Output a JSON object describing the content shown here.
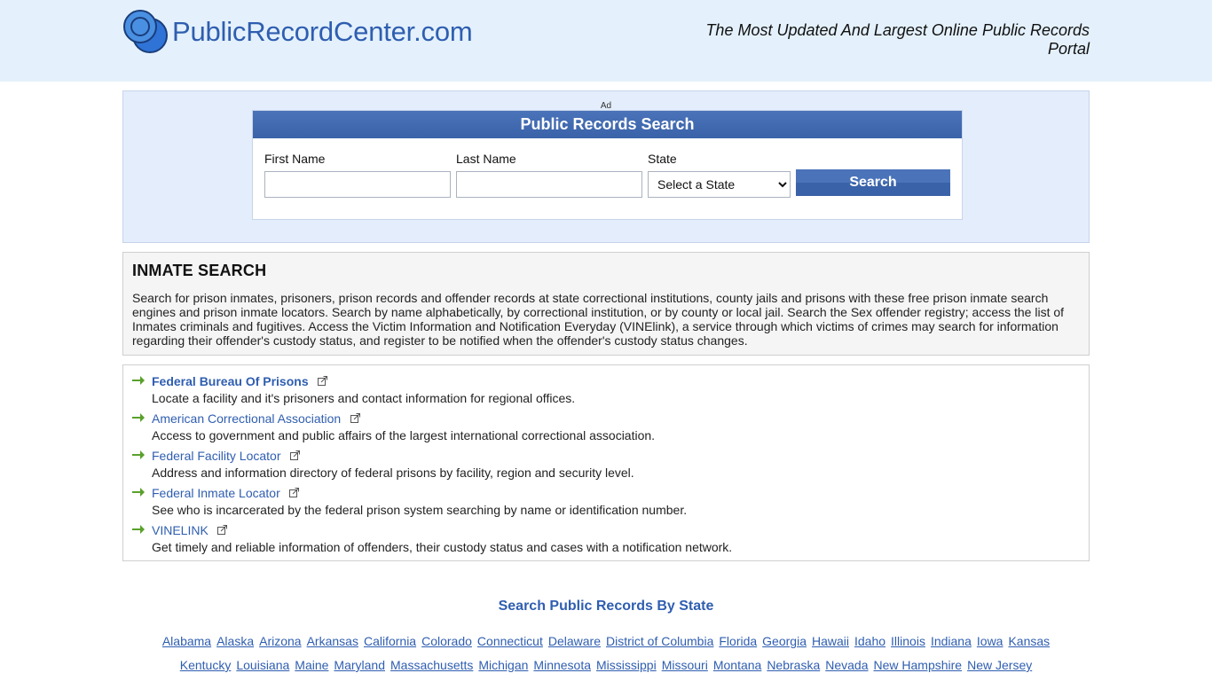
{
  "header": {
    "site_name": "PublicRecordCenter.com",
    "tagline": "The Most Updated And Largest Online Public Records Portal"
  },
  "search": {
    "ad_label": "Ad",
    "title": "Public Records Search",
    "first_name_label": "First Name",
    "last_name_label": "Last Name",
    "state_label": "State",
    "state_selected": "Select a State",
    "button_label": "Search"
  },
  "info": {
    "heading": "INMATE SEARCH",
    "body": "Search for prison inmates, prisoners, prison records and offender records at state correctional institutions, county jails and prisons with these free prison inmate search engines and prison inmate locators. Search by name alphabetically, by correctional institution, or by county or local jail. Search the Sex offender registry; access the list of Inmates criminals and fugitives. Access the Victim Information and Notification Everyday (VINElink), a service through which victims of crimes may search for information regarding their offender's custody status, and register to be notified when the offender's custody status changes."
  },
  "links": [
    {
      "title": "Federal Bureau Of Prisons",
      "desc": "Locate a facility and it's prisoners and contact information for regional offices."
    },
    {
      "title": "American Correctional Association",
      "desc": "Access to government and public affairs of the largest international correctional association."
    },
    {
      "title": "Federal Facility Locator",
      "desc": "Address and information directory of federal prisons by facility, region and security level."
    },
    {
      "title": "Federal Inmate Locator",
      "desc": "See who is incarcerated by the federal prison system searching by name or identification number."
    },
    {
      "title": "VINELINK",
      "desc": "Get timely and reliable information of offenders, their custody status and cases with a notification network."
    }
  ],
  "states": {
    "heading": "Search Public Records By State",
    "row1": [
      "Alabama",
      "Alaska",
      "Arizona",
      "Arkansas",
      "California",
      "Colorado",
      "Connecticut",
      "Delaware",
      "District of Columbia",
      "Florida",
      "Georgia",
      "Hawaii",
      "Idaho",
      "Illinois",
      "Indiana",
      "Iowa",
      "Kansas"
    ],
    "row2": [
      "Kentucky",
      "Louisiana",
      "Maine",
      "Maryland",
      "Massachusetts",
      "Michigan",
      "Minnesota",
      "Mississippi",
      "Missouri",
      "Montana",
      "Nebraska",
      "Nevada",
      "New Hampshire",
      "New Jersey"
    ]
  },
  "colors": {
    "brand_blue": "#2f5eb0",
    "header_bg": "#e4f1fc",
    "arrow_green": "#5aa02c"
  }
}
